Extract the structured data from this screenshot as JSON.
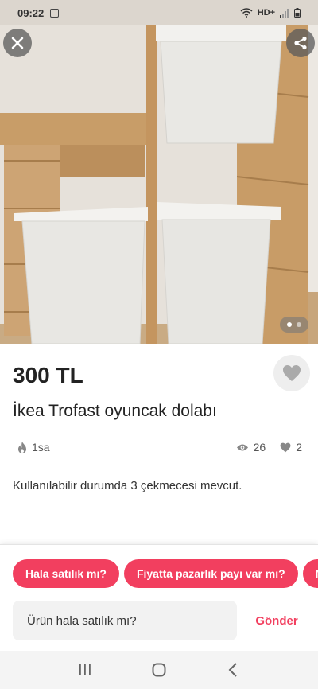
{
  "status_bar": {
    "time": "09:22",
    "network": "HD+"
  },
  "listing": {
    "price": "300 TL",
    "title": "İkea Trofast oyuncak dolabı",
    "posted_ago": "1sa",
    "views": "26",
    "favorites": "2",
    "description": "Kullanılabilir durumda 3 çekmecesi mevcut.",
    "photo_count": 2,
    "photo_index": 1
  },
  "quick_replies": [
    "Hala satılık mı?",
    "Fiyatta pazarlık payı var mı?",
    "N"
  ],
  "message": {
    "value": "Ürün hala satılık mı?",
    "send_label": "Gönder"
  },
  "colors": {
    "accent": "#f23f5f",
    "wood": "#c79a63",
    "bin": "#ececea"
  },
  "icons": [
    "close-icon",
    "share-icon",
    "heart-icon",
    "fire-icon",
    "eye-icon",
    "recents-icon",
    "home-icon",
    "back-icon"
  ]
}
